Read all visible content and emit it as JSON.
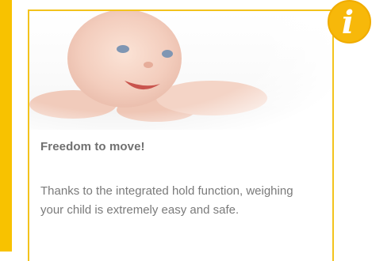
{
  "card": {
    "heading": "Freedom to move!",
    "body": "Thanks to the integrated hold function, weighing your child is extremely easy and safe.",
    "info_icon": "i",
    "hero_image": "baby-photo"
  },
  "colors": {
    "accent": "#f8c200",
    "card_border": "#f3c31d",
    "heading": "#707070",
    "body_text": "#7a7a7a"
  }
}
